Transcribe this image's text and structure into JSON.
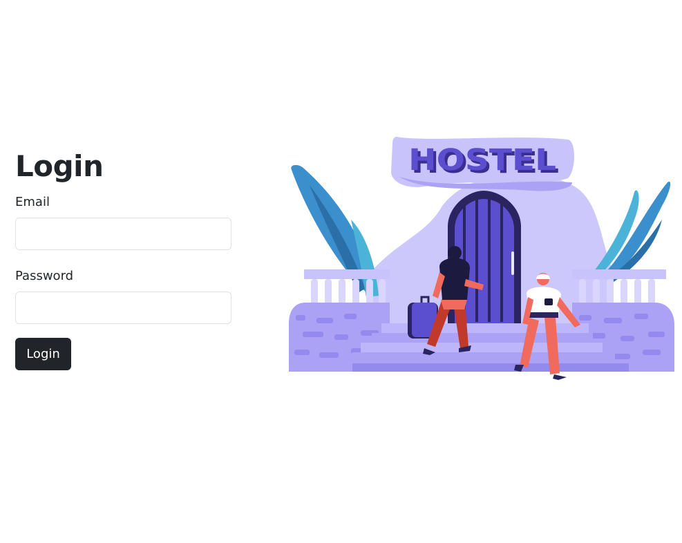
{
  "login": {
    "title": "Login",
    "email_label": "Email",
    "email_value": "",
    "password_label": "Password",
    "password_value": "",
    "button_label": "Login"
  },
  "illustration": {
    "sign_text": "HOSTEL",
    "description": "hostel-entrance-illustration"
  },
  "colors": {
    "primary_button": "#212529",
    "input_border": "#dee2e6",
    "sign_text": "#5b4fd0",
    "building_lavender": "#c9c3fb",
    "door_purple": "#5b4fd0",
    "leaf_blue": "#3a8fcc",
    "stone_purple": "#aba2f5"
  }
}
